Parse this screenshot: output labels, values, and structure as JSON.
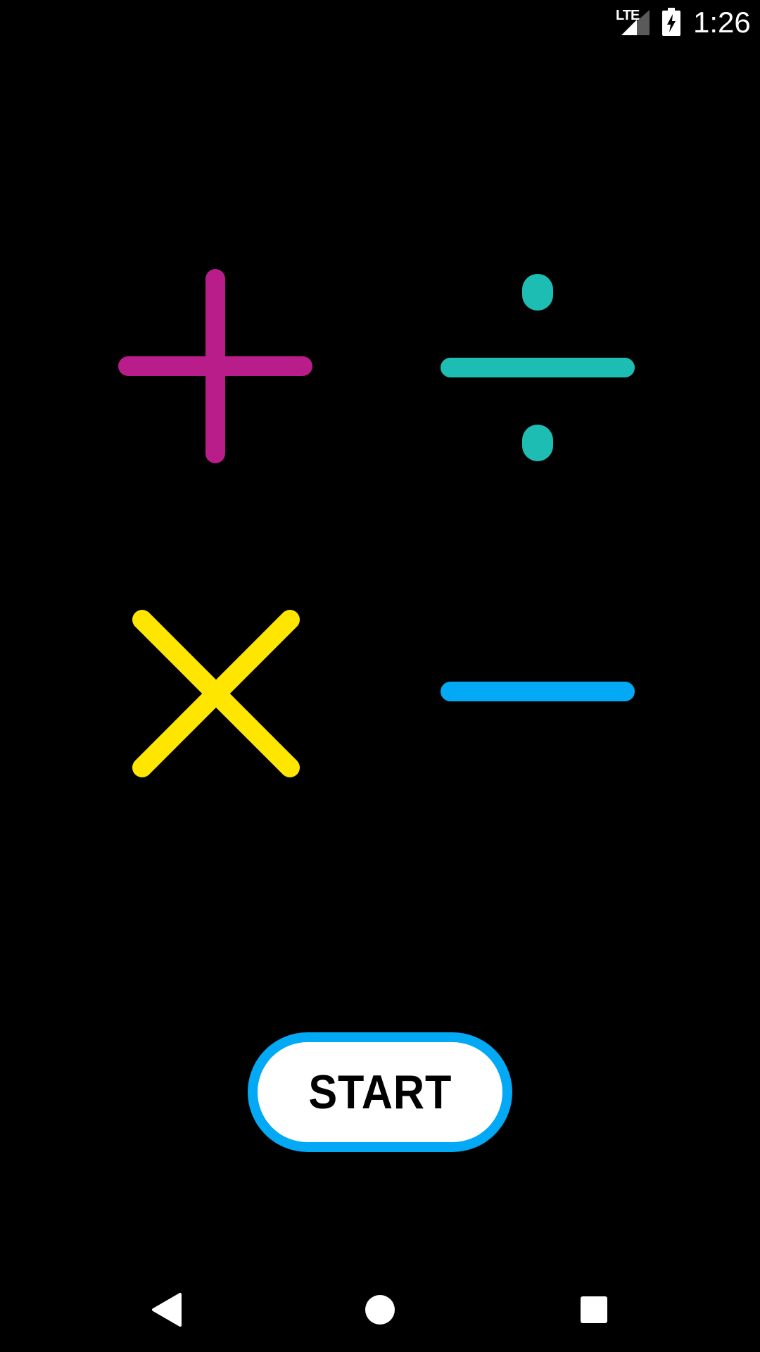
{
  "status_bar": {
    "network_label": "LTE",
    "time": "1:26",
    "icons": [
      "lte-signal-icon",
      "battery-charging-icon"
    ]
  },
  "symbols": {
    "plus": {
      "icon": "plus-icon",
      "color": "#b91d8a"
    },
    "divide": {
      "icon": "divide-icon",
      "color": "#1dbdb4"
    },
    "times": {
      "icon": "multiply-icon",
      "color": "#ffe600"
    },
    "minus": {
      "icon": "minus-icon",
      "color": "#03a9f4"
    }
  },
  "start_button": {
    "label": "START",
    "border_color": "#03a9f4",
    "fill_color": "#ffffff"
  },
  "nav_bar": {
    "icons": [
      "back-icon",
      "home-icon",
      "recents-icon"
    ]
  }
}
